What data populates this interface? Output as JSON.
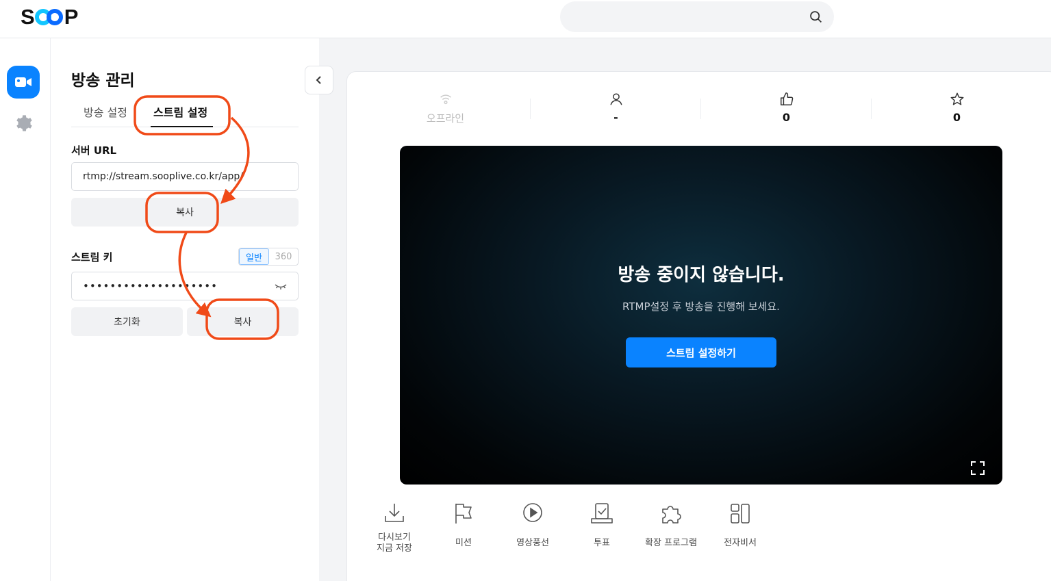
{
  "header": {
    "logo_text_left": "S",
    "logo_text_right": "P",
    "search_placeholder": ""
  },
  "panel": {
    "title": "방송 관리",
    "tabs": [
      {
        "label": "방송 설정",
        "active": false
      },
      {
        "label": "스트림 설정",
        "active": true
      }
    ],
    "server_url_label": "서버 URL",
    "server_url_value": "rtmp://stream.sooplive.co.kr/app/",
    "copy_label": "복사",
    "stream_key_label": "스트림 키",
    "stream_key_modes": [
      "일반",
      "360"
    ],
    "stream_key_value": "••••••••••••••••••••",
    "reset_label": "초기화",
    "copy_key_label": "복사"
  },
  "stats": [
    {
      "label": "오프라인",
      "icon": "signal-icon"
    },
    {
      "label": "-",
      "icon": "user-icon"
    },
    {
      "label": "0",
      "icon": "thumbs-up-icon"
    },
    {
      "label": "0",
      "icon": "star-icon"
    }
  ],
  "player": {
    "title": "방송 중이지 않습니다.",
    "subtitle": "RTMP설정 후 방송을 진행해 보세요.",
    "cta_label": "스트림 설정하기"
  },
  "tools": [
    {
      "label": "다시보기\n지금 저장",
      "icon": "download-icon"
    },
    {
      "label": "미션",
      "icon": "flag-icon"
    },
    {
      "label": "영상풍선",
      "icon": "play-circle-icon"
    },
    {
      "label": "투표",
      "icon": "vote-icon"
    },
    {
      "label": "확장 프로그램",
      "icon": "puzzle-icon"
    },
    {
      "label": "전자비서",
      "icon": "layout-icon"
    }
  ],
  "colors": {
    "accent": "#0a83ff",
    "annotation": "#f04a18"
  }
}
